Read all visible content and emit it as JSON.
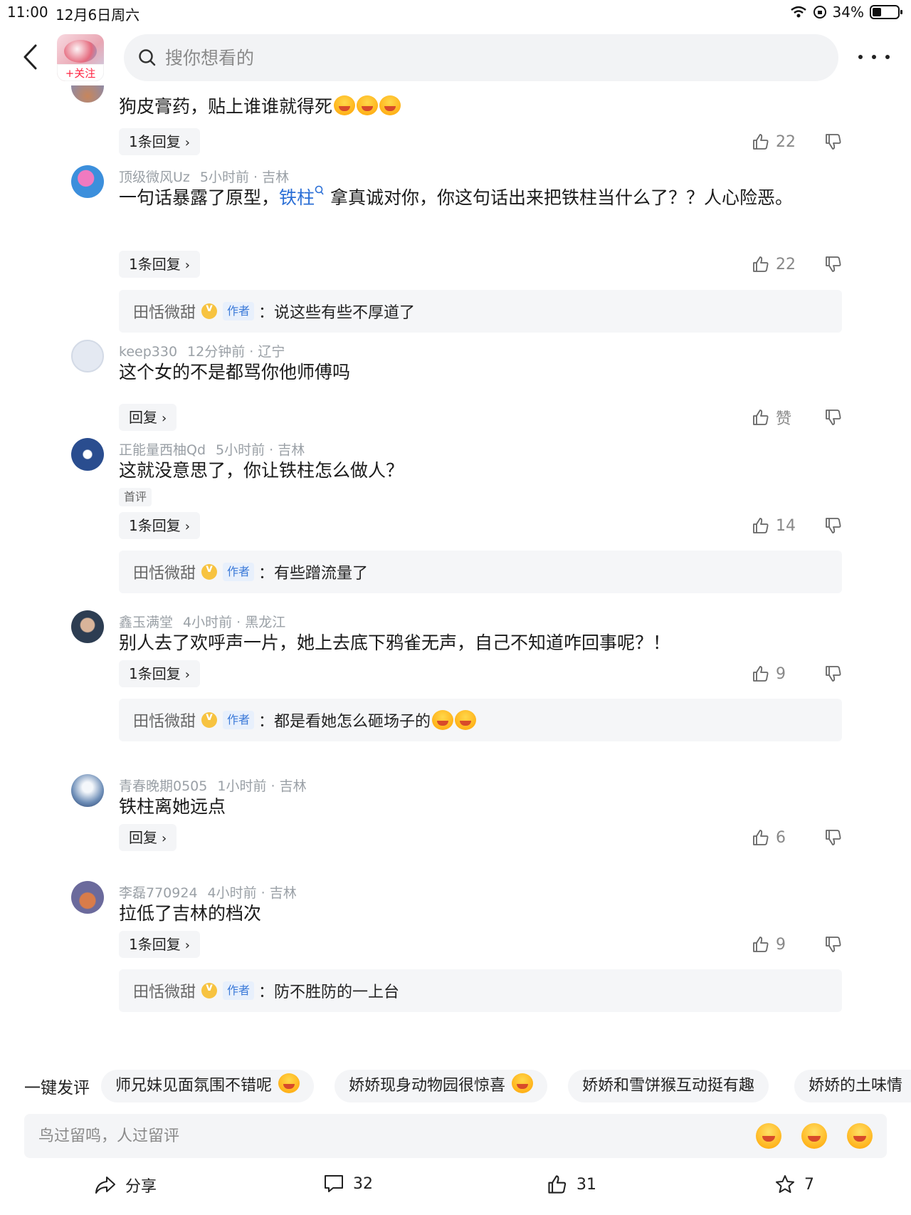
{
  "status_bar": {
    "time": "11:00",
    "date": "12月6日周六",
    "battery": "34%"
  },
  "header": {
    "follow_label": "+关注",
    "search_placeholder": "搜你想看的"
  },
  "comments": [
    {
      "text": "狗皮膏药，贴上谁谁就得死",
      "reply_label": "1条回复",
      "likes": "22"
    },
    {
      "user": "顶级微风Uz",
      "time": "5小时前 · 吉林",
      "text_before": "一句话暴露了原型，",
      "link": "铁柱",
      "text_after": " 拿真诚对你，你这句话出来把铁柱当什么了？？人心险恶。",
      "reply_label": "1条回复",
      "likes": "22",
      "author_reply": {
        "name": "田恬微甜",
        "tag": "作者",
        "text": "：说这些有些不厚道了"
      }
    },
    {
      "user": "keep330",
      "time": "12分钟前 · 辽宁",
      "text": "这个女的不是都骂你他师傅吗",
      "reply_label": "回复",
      "likes": "赞"
    },
    {
      "user": "正能量西柚Qd",
      "time": "5小时前 · 吉林",
      "text": "这就没意思了，你让铁柱怎么做人？",
      "badge": "首评",
      "reply_label": "1条回复",
      "likes": "14",
      "author_reply": {
        "name": "田恬微甜",
        "tag": "作者",
        "text": "：有些蹭流量了"
      }
    },
    {
      "user": "鑫玉满堂",
      "time": "4小时前 · 黑龙江",
      "text": "别人去了欢呼声一片，她上去底下鸦雀无声，自己不知道咋回事呢？！",
      "reply_label": "1条回复",
      "likes": "9",
      "author_reply": {
        "name": "田恬微甜",
        "tag": "作者",
        "text": "：都是看她怎么砸场子的"
      }
    },
    {
      "user": "青春晚期0505",
      "time": "1小时前 · 吉林",
      "text": "铁柱离她远点",
      "reply_label": "回复",
      "likes": "6"
    },
    {
      "user": "李磊770924",
      "time": "4小时前 · 吉林",
      "text": "拉低了吉林的档次",
      "reply_label": "1条回复",
      "likes": "9",
      "author_reply": {
        "name": "田恬微甜",
        "tag": "作者",
        "text": "：防不胜防的一上台"
      }
    }
  ],
  "suggestions": {
    "label": "一键发评",
    "chips": [
      "师兄妹见面氛围不错呢",
      "娇娇现身动物园很惊喜",
      "娇娇和雪饼猴互动挺有趣",
      "娇娇的土味情"
    ]
  },
  "comment_input": {
    "placeholder": "鸟过留鸣，人过留评"
  },
  "bottom_bar": {
    "share_label": "分享",
    "comments_count": "32",
    "likes_count": "31",
    "favorites_count": "7"
  }
}
